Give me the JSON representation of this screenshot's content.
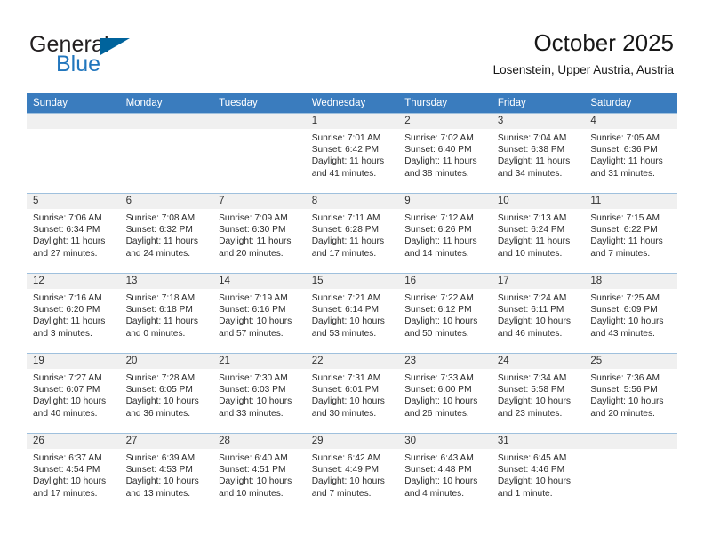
{
  "brand": {
    "word_one": "General",
    "word_two": "Blue",
    "flag_icon": "triangle-flag-icon",
    "colors": {
      "general": "#231f20",
      "blue": "#2176bd",
      "flag": "#00639c"
    }
  },
  "header": {
    "title": "October 2025",
    "subtitle": "Losenstein, Upper Austria, Austria"
  },
  "theme": {
    "header_row_bg": "#3a7cbe",
    "header_row_text": "#ffffff",
    "daynum_bg": "#f0f0f0",
    "cell_border": "#9fc0dd"
  },
  "weekdays": [
    "Sunday",
    "Monday",
    "Tuesday",
    "Wednesday",
    "Thursday",
    "Friday",
    "Saturday"
  ],
  "labels": {
    "sunrise_prefix": "Sunrise:",
    "sunset_prefix": "Sunset:",
    "daylight_prefix": "Daylight:"
  },
  "weeks": [
    [
      {
        "day": "",
        "blank": true
      },
      {
        "day": "",
        "blank": true
      },
      {
        "day": "",
        "blank": true
      },
      {
        "day": "1",
        "sunrise": "Sunrise: 7:01 AM",
        "sunset": "Sunset: 6:42 PM",
        "daylight": "Daylight: 11 hours and 41 minutes."
      },
      {
        "day": "2",
        "sunrise": "Sunrise: 7:02 AM",
        "sunset": "Sunset: 6:40 PM",
        "daylight": "Daylight: 11 hours and 38 minutes."
      },
      {
        "day": "3",
        "sunrise": "Sunrise: 7:04 AM",
        "sunset": "Sunset: 6:38 PM",
        "daylight": "Daylight: 11 hours and 34 minutes."
      },
      {
        "day": "4",
        "sunrise": "Sunrise: 7:05 AM",
        "sunset": "Sunset: 6:36 PM",
        "daylight": "Daylight: 11 hours and 31 minutes."
      }
    ],
    [
      {
        "day": "5",
        "sunrise": "Sunrise: 7:06 AM",
        "sunset": "Sunset: 6:34 PM",
        "daylight": "Daylight: 11 hours and 27 minutes."
      },
      {
        "day": "6",
        "sunrise": "Sunrise: 7:08 AM",
        "sunset": "Sunset: 6:32 PM",
        "daylight": "Daylight: 11 hours and 24 minutes."
      },
      {
        "day": "7",
        "sunrise": "Sunrise: 7:09 AM",
        "sunset": "Sunset: 6:30 PM",
        "daylight": "Daylight: 11 hours and 20 minutes."
      },
      {
        "day": "8",
        "sunrise": "Sunrise: 7:11 AM",
        "sunset": "Sunset: 6:28 PM",
        "daylight": "Daylight: 11 hours and 17 minutes."
      },
      {
        "day": "9",
        "sunrise": "Sunrise: 7:12 AM",
        "sunset": "Sunset: 6:26 PM",
        "daylight": "Daylight: 11 hours and 14 minutes."
      },
      {
        "day": "10",
        "sunrise": "Sunrise: 7:13 AM",
        "sunset": "Sunset: 6:24 PM",
        "daylight": "Daylight: 11 hours and 10 minutes."
      },
      {
        "day": "11",
        "sunrise": "Sunrise: 7:15 AM",
        "sunset": "Sunset: 6:22 PM",
        "daylight": "Daylight: 11 hours and 7 minutes."
      }
    ],
    [
      {
        "day": "12",
        "sunrise": "Sunrise: 7:16 AM",
        "sunset": "Sunset: 6:20 PM",
        "daylight": "Daylight: 11 hours and 3 minutes."
      },
      {
        "day": "13",
        "sunrise": "Sunrise: 7:18 AM",
        "sunset": "Sunset: 6:18 PM",
        "daylight": "Daylight: 11 hours and 0 minutes."
      },
      {
        "day": "14",
        "sunrise": "Sunrise: 7:19 AM",
        "sunset": "Sunset: 6:16 PM",
        "daylight": "Daylight: 10 hours and 57 minutes."
      },
      {
        "day": "15",
        "sunrise": "Sunrise: 7:21 AM",
        "sunset": "Sunset: 6:14 PM",
        "daylight": "Daylight: 10 hours and 53 minutes."
      },
      {
        "day": "16",
        "sunrise": "Sunrise: 7:22 AM",
        "sunset": "Sunset: 6:12 PM",
        "daylight": "Daylight: 10 hours and 50 minutes."
      },
      {
        "day": "17",
        "sunrise": "Sunrise: 7:24 AM",
        "sunset": "Sunset: 6:11 PM",
        "daylight": "Daylight: 10 hours and 46 minutes."
      },
      {
        "day": "18",
        "sunrise": "Sunrise: 7:25 AM",
        "sunset": "Sunset: 6:09 PM",
        "daylight": "Daylight: 10 hours and 43 minutes."
      }
    ],
    [
      {
        "day": "19",
        "sunrise": "Sunrise: 7:27 AM",
        "sunset": "Sunset: 6:07 PM",
        "daylight": "Daylight: 10 hours and 40 minutes."
      },
      {
        "day": "20",
        "sunrise": "Sunrise: 7:28 AM",
        "sunset": "Sunset: 6:05 PM",
        "daylight": "Daylight: 10 hours and 36 minutes."
      },
      {
        "day": "21",
        "sunrise": "Sunrise: 7:30 AM",
        "sunset": "Sunset: 6:03 PM",
        "daylight": "Daylight: 10 hours and 33 minutes."
      },
      {
        "day": "22",
        "sunrise": "Sunrise: 7:31 AM",
        "sunset": "Sunset: 6:01 PM",
        "daylight": "Daylight: 10 hours and 30 minutes."
      },
      {
        "day": "23",
        "sunrise": "Sunrise: 7:33 AM",
        "sunset": "Sunset: 6:00 PM",
        "daylight": "Daylight: 10 hours and 26 minutes."
      },
      {
        "day": "24",
        "sunrise": "Sunrise: 7:34 AM",
        "sunset": "Sunset: 5:58 PM",
        "daylight": "Daylight: 10 hours and 23 minutes."
      },
      {
        "day": "25",
        "sunrise": "Sunrise: 7:36 AM",
        "sunset": "Sunset: 5:56 PM",
        "daylight": "Daylight: 10 hours and 20 minutes."
      }
    ],
    [
      {
        "day": "26",
        "sunrise": "Sunrise: 6:37 AM",
        "sunset": "Sunset: 4:54 PM",
        "daylight": "Daylight: 10 hours and 17 minutes."
      },
      {
        "day": "27",
        "sunrise": "Sunrise: 6:39 AM",
        "sunset": "Sunset: 4:53 PM",
        "daylight": "Daylight: 10 hours and 13 minutes."
      },
      {
        "day": "28",
        "sunrise": "Sunrise: 6:40 AM",
        "sunset": "Sunset: 4:51 PM",
        "daylight": "Daylight: 10 hours and 10 minutes."
      },
      {
        "day": "29",
        "sunrise": "Sunrise: 6:42 AM",
        "sunset": "Sunset: 4:49 PM",
        "daylight": "Daylight: 10 hours and 7 minutes."
      },
      {
        "day": "30",
        "sunrise": "Sunrise: 6:43 AM",
        "sunset": "Sunset: 4:48 PM",
        "daylight": "Daylight: 10 hours and 4 minutes."
      },
      {
        "day": "31",
        "sunrise": "Sunrise: 6:45 AM",
        "sunset": "Sunset: 4:46 PM",
        "daylight": "Daylight: 10 hours and 1 minute."
      },
      {
        "day": "",
        "blank": true
      }
    ]
  ]
}
